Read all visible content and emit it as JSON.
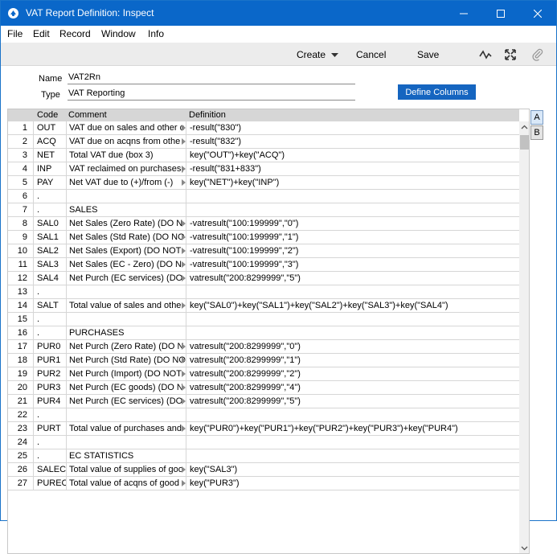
{
  "window": {
    "title": "VAT Report Definition: Inspect"
  },
  "menu": [
    "File",
    "Edit",
    "Record",
    "Window",
    "Info"
  ],
  "toolbar": {
    "create": "Create",
    "cancel": "Cancel",
    "save": "Save"
  },
  "form": {
    "name_label": "Name",
    "name_value": "VAT2Rn",
    "type_label": "Type",
    "type_value": "VAT Reporting",
    "define_columns": "Define Columns"
  },
  "grid": {
    "headers": {
      "code": "Code",
      "comment": "Comment",
      "definition": "Definition"
    },
    "rows": [
      {
        "n": "1",
        "code": "OUT",
        "comment": "VAT due on sales and other o",
        "def": "-result(\"830\")",
        "t": true
      },
      {
        "n": "2",
        "code": "ACQ",
        "comment": "VAT due on acqns from othe",
        "def": "-result(\"832\")",
        "t": true
      },
      {
        "n": "3",
        "code": "NET",
        "comment": "Total VAT due (box 3)",
        "def": "key(\"OUT\")+key(\"ACQ\")",
        "t": false
      },
      {
        "n": "4",
        "code": "INP",
        "comment": "VAT reclaimed on purchases,",
        "def": "-result(\"831+833\")",
        "t": true
      },
      {
        "n": "5",
        "code": "PAY",
        "comment": "Net VAT due to (+)/from (-)",
        "def": "key(\"NET\")+key(\"INP\")",
        "t": true
      },
      {
        "n": "6",
        "code": ".",
        "comment": "",
        "def": "",
        "t": false
      },
      {
        "n": "7",
        "code": ".",
        "comment": "SALES",
        "def": "",
        "t": false
      },
      {
        "n": "8",
        "code": "SAL0",
        "comment": "Net Sales (Zero Rate)  (DO N",
        "def": "-vatresult(\"100:199999\",\"0\")",
        "t": true
      },
      {
        "n": "9",
        "code": "SAL1",
        "comment": "Net Sales (Std Rate)  (DO NO",
        "def": "-vatresult(\"100:199999\",\"1\")",
        "t": true
      },
      {
        "n": "10",
        "code": "SAL2",
        "comment": "Net Sales (Export)  (DO NOT",
        "def": "-vatresult(\"100:199999\",\"2\")",
        "t": true
      },
      {
        "n": "11",
        "code": "SAL3",
        "comment": "Net Sales (EC - Zero)  (DO N",
        "def": "-vatresult(\"100:199999\",\"3\")",
        "t": true
      },
      {
        "n": "12",
        "code": "SAL4",
        "comment": "Net Purch (EC services)  (DO",
        "def": "vatresult(\"200:8299999\",\"5\")",
        "t": true
      },
      {
        "n": "13",
        "code": ".",
        "comment": "",
        "def": "",
        "t": false
      },
      {
        "n": "14",
        "code": "SALT",
        "comment": "Total value of sales and othe",
        "def": "key(\"SAL0\")+key(\"SAL1\")+key(\"SAL2\")+key(\"SAL3\")+key(\"SAL4\")",
        "t": true
      },
      {
        "n": "15",
        "code": ".",
        "comment": "",
        "def": "",
        "t": false
      },
      {
        "n": "16",
        "code": ".",
        "comment": "PURCHASES",
        "def": "",
        "t": false
      },
      {
        "n": "17",
        "code": "PUR0",
        "comment": "Net Purch (Zero Rate)  (DO N",
        "def": "vatresult(\"200:8299999\",\"0\")",
        "t": true
      },
      {
        "n": "18",
        "code": "PUR1",
        "comment": "Net Purch (Std Rate)  (DO NO",
        "def": "vatresult(\"200:8299999\",\"1\")",
        "t": true
      },
      {
        "n": "19",
        "code": "PUR2",
        "comment": "Net Purch (Import)  (DO NOT",
        "def": "vatresult(\"200:8299999\",\"2\")",
        "t": true
      },
      {
        "n": "20",
        "code": "PUR3",
        "comment": "Net Purch (EC goods)  (DO N",
        "def": "vatresult(\"200:8299999\",\"4\")",
        "t": true
      },
      {
        "n": "21",
        "code": "PUR4",
        "comment": "Net Purch (EC services)  (DO",
        "def": "vatresult(\"200:8299999\",\"5\")",
        "t": true
      },
      {
        "n": "22",
        "code": ".",
        "comment": "",
        "def": "",
        "t": false
      },
      {
        "n": "23",
        "code": "PURT",
        "comment": "Total value of purchases and",
        "def": "key(\"PUR0\")+key(\"PUR1\")+key(\"PUR2\")+key(\"PUR3\")+key(\"PUR4\")",
        "t": true
      },
      {
        "n": "24",
        "code": ".",
        "comment": "",
        "def": "",
        "t": false
      },
      {
        "n": "25",
        "code": ".",
        "comment": "EC STATISTICS",
        "def": "",
        "t": false
      },
      {
        "n": "26",
        "code": "SALEC",
        "comment": "Total value of supplies of goo",
        "def": "key(\"SAL3\")",
        "t": true
      },
      {
        "n": "27",
        "code": "PUREC",
        "comment": "Total value of acqns of good",
        "def": "key(\"PUR3\")",
        "t": true
      }
    ]
  },
  "tabs": [
    "A",
    "B"
  ]
}
